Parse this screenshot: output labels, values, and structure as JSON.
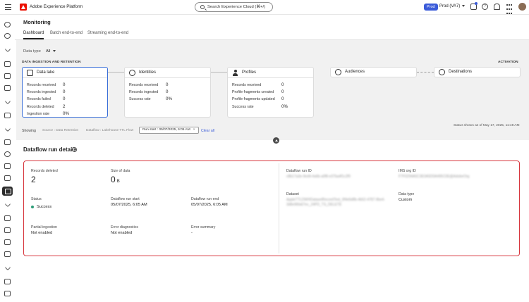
{
  "topbar": {
    "app_title": "Adobe Experience Platform",
    "search_placeholder": "Search Experience Cloud (⌘+/)",
    "env_badge": "Prod",
    "sandbox": "Prod (VA7)"
  },
  "rail": {
    "icons": [
      "home-icon",
      "people-icon",
      "chevron-icon",
      "hand-icon",
      "box-icon",
      "folder-icon",
      "chevron-icon",
      "segment-icon",
      "chevron-icon",
      "flow-icon",
      "location-icon",
      "database-icon",
      "list-icon",
      "monitor-icon",
      "chevron-icon",
      "alert-icon",
      "doc-icon",
      "link-icon",
      "tag-icon",
      "chevron-icon",
      "key-icon",
      "lock-icon"
    ]
  },
  "page": {
    "title": "Monitoring",
    "tabs": [
      {
        "label": "Dashboard",
        "active": true
      },
      {
        "label": "Batch end-to-end",
        "active": false
      },
      {
        "label": "Streaming end-to-end",
        "active": false
      }
    ],
    "data_type_label": "Data type",
    "data_type_value": "All",
    "section_left": "DATA INGESTION AND RETENTION",
    "section_right": "ACTIVATION"
  },
  "cards": {
    "data_lake": {
      "title": "Data lake",
      "metrics": [
        {
          "label": "Records received",
          "value": "0"
        },
        {
          "label": "Records ingested",
          "value": "0"
        },
        {
          "label": "Records failed",
          "value": "0"
        },
        {
          "label": "Records deleted",
          "value": "2"
        },
        {
          "label": "Ingestion rate",
          "value": "0%"
        }
      ]
    },
    "identities": {
      "title": "Identities",
      "metrics": [
        {
          "label": "Records received",
          "value": "0"
        },
        {
          "label": "Records ingested",
          "value": "0"
        },
        {
          "label": "Success rate",
          "value": "0%"
        }
      ]
    },
    "profiles": {
      "title": "Profiles",
      "metrics": [
        {
          "label": "Records received",
          "value": "0"
        },
        {
          "label": "Profile fragments created",
          "value": "0"
        },
        {
          "label": "Profile fragments updated",
          "value": "0"
        },
        {
          "label": "Success rate",
          "value": "0%"
        }
      ]
    },
    "audiences": {
      "title": "Audiences"
    },
    "destinations": {
      "title": "Destinations"
    }
  },
  "status_shown": "Status shown as of May 17, 2025, 11:48 AM",
  "filters": {
    "showing": "Showing",
    "tag1": "Source : Data Retention",
    "tag2": "Dataflow : Lakehouse TTL Flow",
    "chip": "Run start : 05/07/2025, 6:05 AM",
    "clear": "Clear all"
  },
  "details": {
    "title": "Dataflow run details",
    "records_deleted_label": "Records deleted",
    "records_deleted_value": "2",
    "size_label": "Size of data",
    "size_value": "0",
    "size_unit": "B",
    "status_label": "Status",
    "status_value": "Success",
    "run_start_label": "Dataflow run start",
    "run_start_value": "05/07/2025, 6:05 AM",
    "run_end_label": "Dataflow run end",
    "run_end_value": "05/07/2025, 6:05 AM",
    "partial_label": "Partial ingestion",
    "partial_value": "Not enabled",
    "diag_label": "Error diagnostics",
    "diag_value": "Not enabled",
    "err_summary_label": "Error summary",
    "err_summary_value": "-",
    "run_id_label": "Dataflow run ID",
    "run_id_value": "c8b17a3e-9ed4-4a6b-a0f8-e37ba4f1c2f0",
    "ims_label": "IMS org ID",
    "ims_value": "F7F0294A5C3E0A5D0A495C0E@AdobeOrg",
    "dataset_label": "Dataset",
    "dataset_value": "AppleTTLDWHDatasetRecordTest_9f4e6d8b-4b52-4787-9be4-3d8e96fa67ec_24PD_TS_DELETE",
    "data_type_label": "Data type",
    "data_type_value": "Custom"
  }
}
